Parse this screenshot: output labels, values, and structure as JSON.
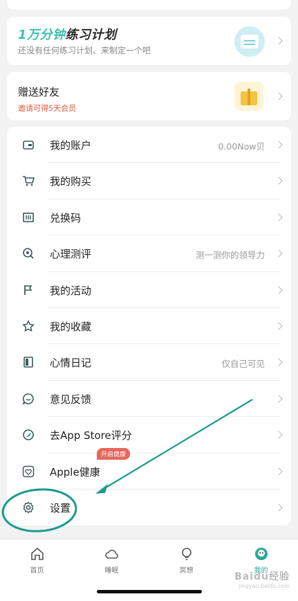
{
  "plan": {
    "title_highlight": "1万分钟",
    "title_rest": "练习计划",
    "subtitle": "还没有任何练习计划、来制定一个吧"
  },
  "friend": {
    "title": "赠送好友",
    "subtitle": "邀请可得5天会员"
  },
  "menu": {
    "items": [
      {
        "label": "我的账户",
        "value": "0.00Now贝",
        "icon": "wallet-icon"
      },
      {
        "label": "我的购买",
        "value": "",
        "icon": "cart-icon"
      },
      {
        "label": "兑换码",
        "value": "",
        "icon": "barcode-icon"
      },
      {
        "label": "心理测评",
        "value": "测一测你的领导力",
        "icon": "assessment-icon"
      },
      {
        "label": "我的活动",
        "value": "",
        "icon": "flag-icon"
      },
      {
        "label": "我的收藏",
        "value": "",
        "icon": "star-icon"
      },
      {
        "label": "心情日记",
        "value": "仅自己可见",
        "icon": "diary-icon"
      },
      {
        "label": "意见反馈",
        "value": "",
        "icon": "feedback-icon"
      },
      {
        "label": "去App Store评分",
        "value": "",
        "icon": "rate-icon"
      },
      {
        "label": "Apple健康",
        "value": "",
        "icon": "heart-icon",
        "badge": "开启健康"
      },
      {
        "label": "设置",
        "value": "",
        "icon": "gear-icon"
      }
    ]
  },
  "tabs": [
    {
      "label": "首页",
      "icon": "home-icon"
    },
    {
      "label": "睡眠",
      "icon": "cloud-icon"
    },
    {
      "label": "冥想",
      "icon": "bulb-icon"
    },
    {
      "label": "我的",
      "icon": "profile-icon",
      "active": true
    }
  ],
  "watermark": {
    "text": "Baidu经验",
    "sub": "jingyan.baidu.com"
  },
  "colors": {
    "accent": "#2aa99a",
    "annotation": "#1a9a8c",
    "badge": "#e8665a",
    "invite": "#e05a3a"
  }
}
